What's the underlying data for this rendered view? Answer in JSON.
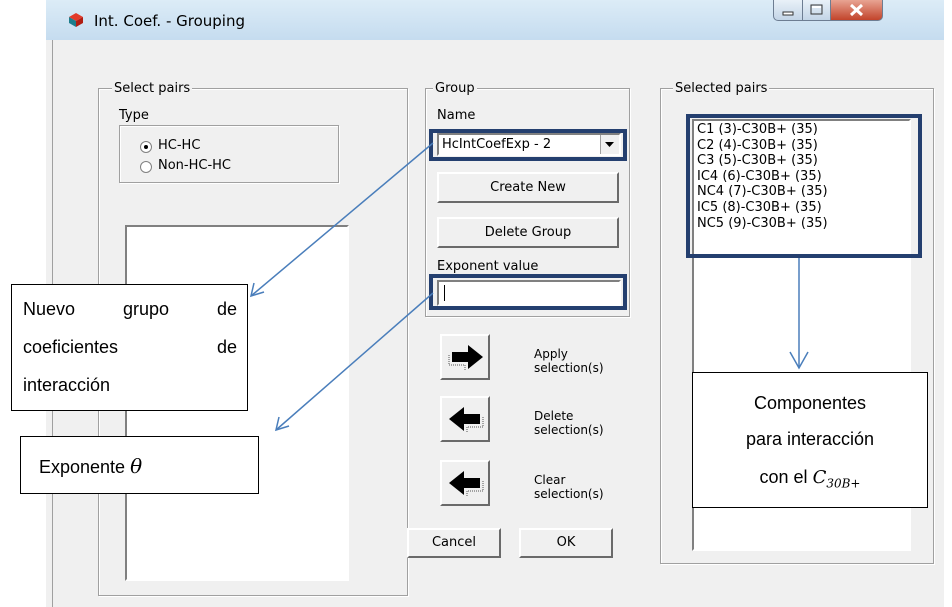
{
  "window": {
    "title": "Int. Coef. - Grouping"
  },
  "select_pairs": {
    "legend": "Select pairs",
    "type_label": "Type",
    "options": [
      {
        "label": "HC-HC",
        "selected": true
      },
      {
        "label": "Non-HC-HC",
        "selected": false
      }
    ]
  },
  "group": {
    "legend": "Group",
    "name_label": "Name",
    "name_value": "HcIntCoefExp - 2",
    "create_label": "Create New",
    "delete_label": "Delete Group",
    "exponent_label": "Exponent value",
    "exponent_value": ""
  },
  "actions": {
    "apply": [
      "Apply",
      "selection(s)"
    ],
    "delete": [
      "Delete",
      "selection(s)"
    ],
    "clear": [
      "Clear",
      "selection(s)"
    ],
    "cancel": "Cancel",
    "ok": "OK"
  },
  "selected_pairs": {
    "legend": "Selected pairs",
    "items": [
      "C1 (3)-C30B+ (35)",
      "C2 (4)-C30B+ (35)",
      "C3 (5)-C30B+ (35)",
      "IC4 (6)-C30B+ (35)",
      "NC4 (7)-C30B+ (35)",
      "IC5 (8)-C30B+ (35)",
      "NC5 (9)-C30B+ (35)"
    ]
  },
  "annotations": {
    "group": [
      "Nuevo grupo de",
      "coeficientes de",
      "interacción"
    ],
    "group_words": [
      [
        "Nuevo",
        "grupo",
        "de"
      ],
      [
        "coeficientes",
        "de"
      ],
      [
        "interacción"
      ]
    ],
    "exponent": "Exponente",
    "exponent_symbol": "θ",
    "components": [
      "Componentes",
      "para interacción",
      "con el"
    ],
    "components_symbol": "C",
    "components_subscript": "30B+"
  },
  "colors": {
    "highlight": "#243f6f",
    "arrow": "#4a7ebb"
  }
}
